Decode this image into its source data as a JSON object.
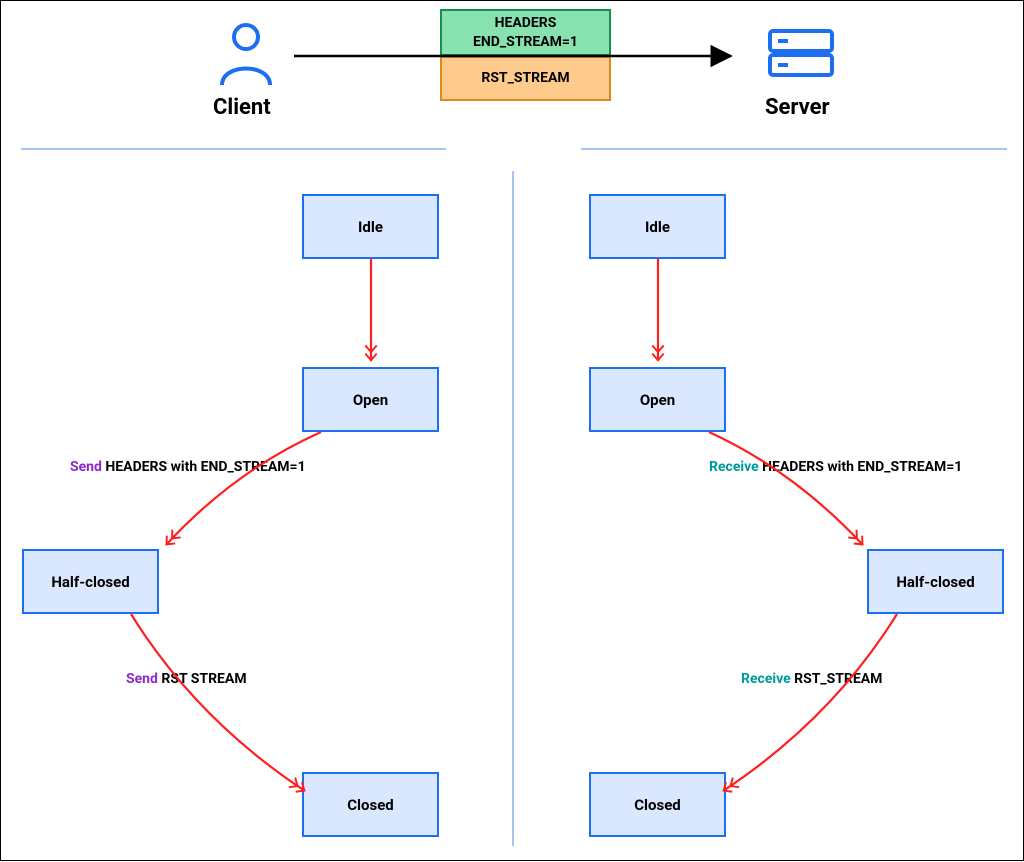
{
  "header": {
    "client_label": "Client",
    "server_label": "Server",
    "msg1_line1": "HEADERS",
    "msg1_line2": "END_STREAM=1",
    "msg2": "RST_STREAM"
  },
  "states": {
    "idle": "Idle",
    "open": "Open",
    "half_closed": "Half-closed",
    "closed": "Closed"
  },
  "client": {
    "send_headers_prefix": "Send",
    "send_headers_rest": " HEADERS with END_STREAM=1",
    "send_rst_prefix": "Send",
    "send_rst_rest": " RST STREAM"
  },
  "server": {
    "recv_headers_prefix": "Receive",
    "recv_headers_rest": " HEADERS with END_STREAM=1",
    "recv_rst_prefix": "Receive",
    "recv_rst_rest": " RST_STREAM"
  },
  "chart_data": {
    "type": "state-diagram",
    "actors": [
      "Client",
      "Server"
    ],
    "messages_over_arrow": [
      "HEADERS END_STREAM=1",
      "RST_STREAM"
    ],
    "client_transitions": [
      {
        "from": "Idle",
        "to": "Open",
        "event": null
      },
      {
        "from": "Open",
        "to": "Half-closed",
        "event": "Send HEADERS with END_STREAM=1"
      },
      {
        "from": "Half-closed",
        "to": "Closed",
        "event": "Send RST STREAM"
      }
    ],
    "server_transitions": [
      {
        "from": "Idle",
        "to": "Open",
        "event": null
      },
      {
        "from": "Open",
        "to": "Half-closed",
        "event": "Receive HEADERS with END_STREAM=1"
      },
      {
        "from": "Half-closed",
        "to": "Closed",
        "event": "Receive RST_STREAM"
      }
    ]
  }
}
